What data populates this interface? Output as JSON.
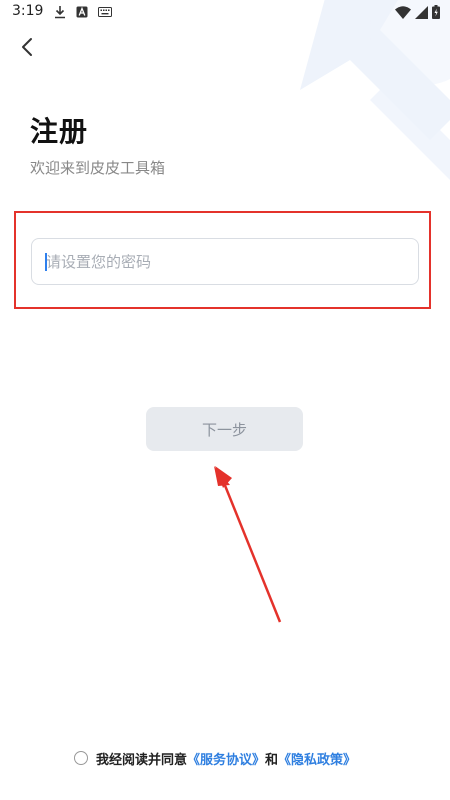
{
  "status_bar": {
    "time": "3:19",
    "left_icons": [
      "download-icon",
      "app-a-icon",
      "keyboard-icon"
    ],
    "right_icons": [
      "wifi-icon",
      "signal-icon",
      "battery-icon"
    ]
  },
  "header": {
    "back_icon": "chevron-left-icon"
  },
  "title": "注册",
  "subtitle": "欢迎来到皮皮工具箱",
  "password_field": {
    "value": "",
    "placeholder": "请设置您的密码"
  },
  "next_button": {
    "label": "下一步"
  },
  "agreement": {
    "prefix": "我经阅读并同意",
    "service_link": "《服务协议》",
    "conjunction": "和",
    "privacy_link": "《隐私政策》",
    "checked": false
  },
  "colors": {
    "accent": "#2f7fe0",
    "annotation": "#e4322b",
    "button_bg": "#e7eaee",
    "button_text": "#8c939d"
  }
}
